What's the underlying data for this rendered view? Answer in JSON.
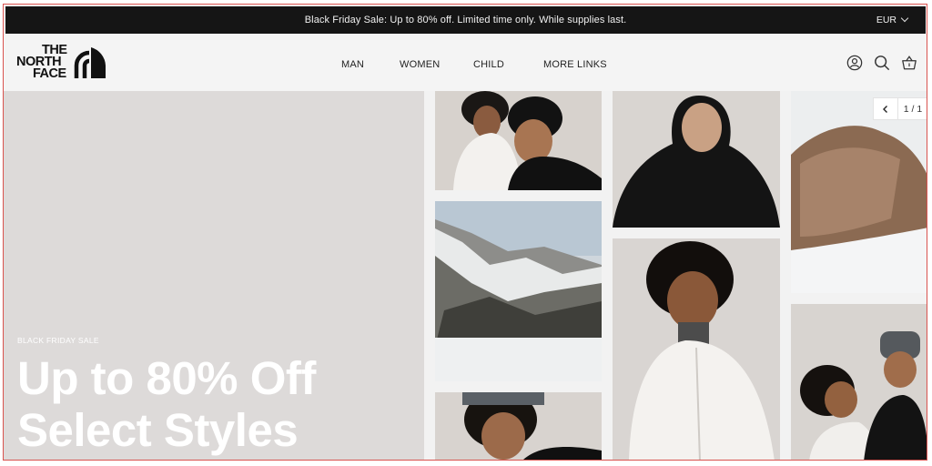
{
  "announcement": {
    "text": "Black Friday Sale: Up to 80% off. Limited time only. While supplies last.",
    "currency": "EUR"
  },
  "brand": {
    "logo_line1": "THE",
    "logo_line2": "NORTH",
    "logo_line3": "FACE"
  },
  "nav": {
    "items": [
      "MAN",
      "WOMEN",
      "CHILD",
      "MORE LINKS"
    ]
  },
  "header_icons": [
    "account-icon",
    "search-icon",
    "basket-icon"
  ],
  "hero": {
    "tag": "BLACK FRIDAY SALE",
    "title_line1": "Up to 80% Off",
    "title_line2": "Select Styles"
  },
  "slider": {
    "counter": "1 / 1"
  },
  "colors": {
    "announce_bg": "#151515",
    "header_bg": "#f4f4f4",
    "hero_left_bg": "#dddad9",
    "hero_text": "#ffffff"
  }
}
